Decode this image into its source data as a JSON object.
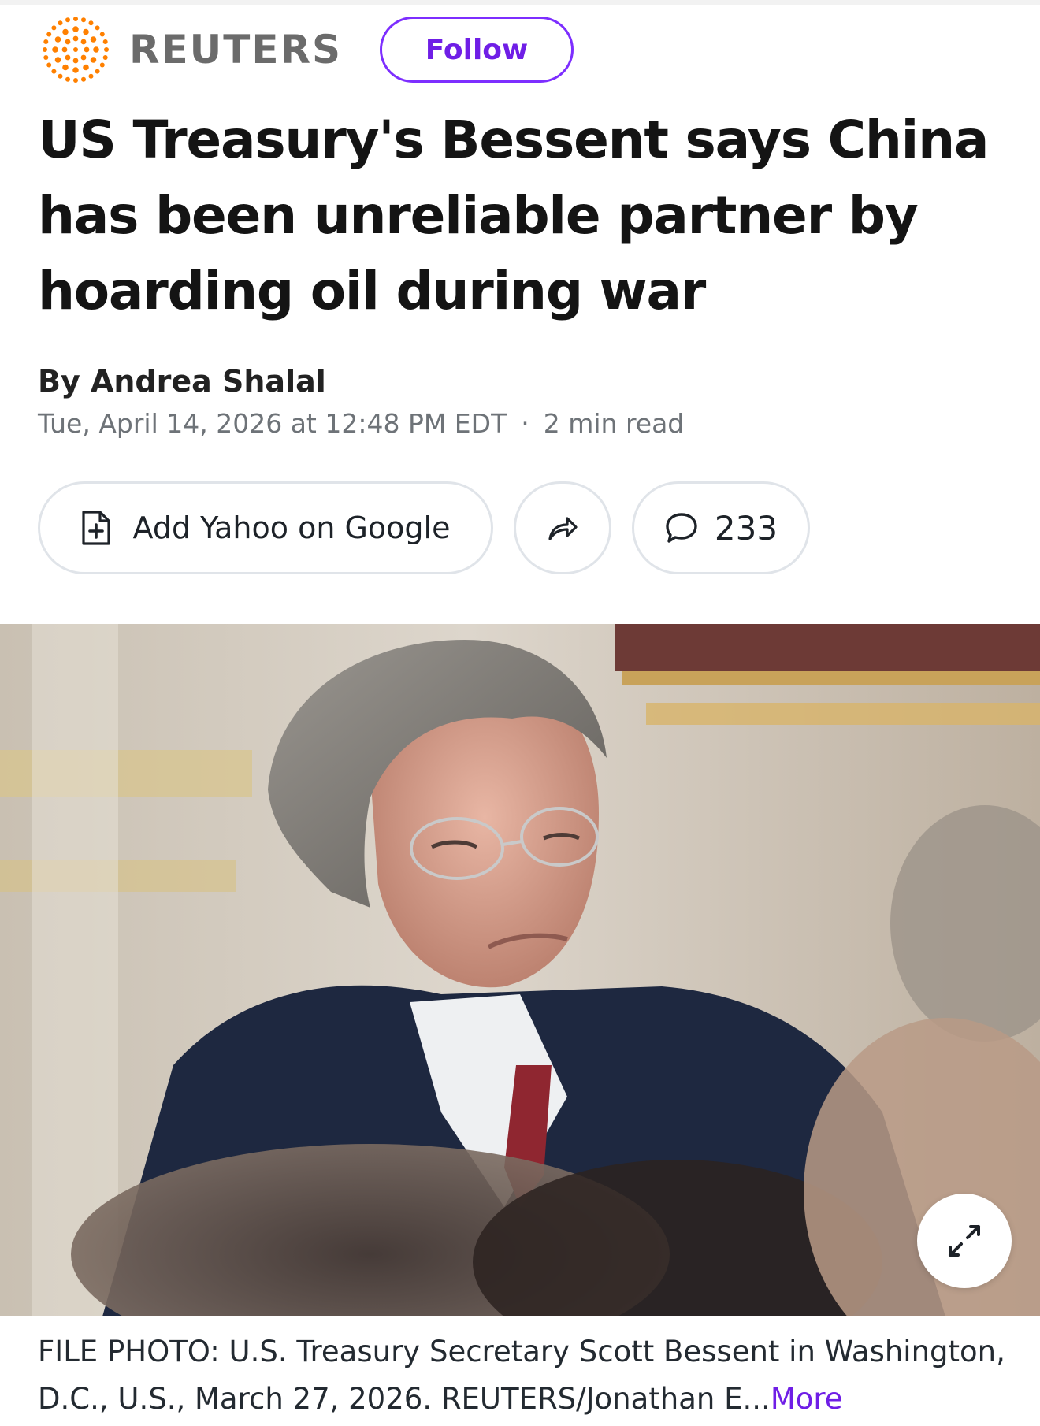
{
  "header": {
    "publisher": "REUTERS",
    "follow_label": "Follow",
    "logo_icon": "reuters-dotted-sunburst-logo",
    "accent_color": "#7d2eff",
    "logo_color": "#ff8000"
  },
  "article": {
    "headline": "US Treasury's Bessent says China has been unreliable partner by hoarding oil during war",
    "byline": "By Andrea Shalal",
    "date": "Tue, April 14, 2026 at 12:48 PM EDT",
    "separator": "·",
    "read_time": "2 min read"
  },
  "actions": {
    "google_label": "Add Yahoo on Google",
    "google_icon": "document-plus-icon",
    "share_icon": "share-arrow-icon",
    "comment_icon": "speech-bubble-icon",
    "comment_count": "233"
  },
  "photo": {
    "expand_icon": "expand-arrows-icon"
  },
  "caption": {
    "text": "FILE PHOTO: U.S. Treasury Secretary Scott Bessent in Washington, D.C., U.S., March 27, 2026. REUTERS/Jonathan E",
    "ellipsis": "...",
    "more_label": "More"
  }
}
